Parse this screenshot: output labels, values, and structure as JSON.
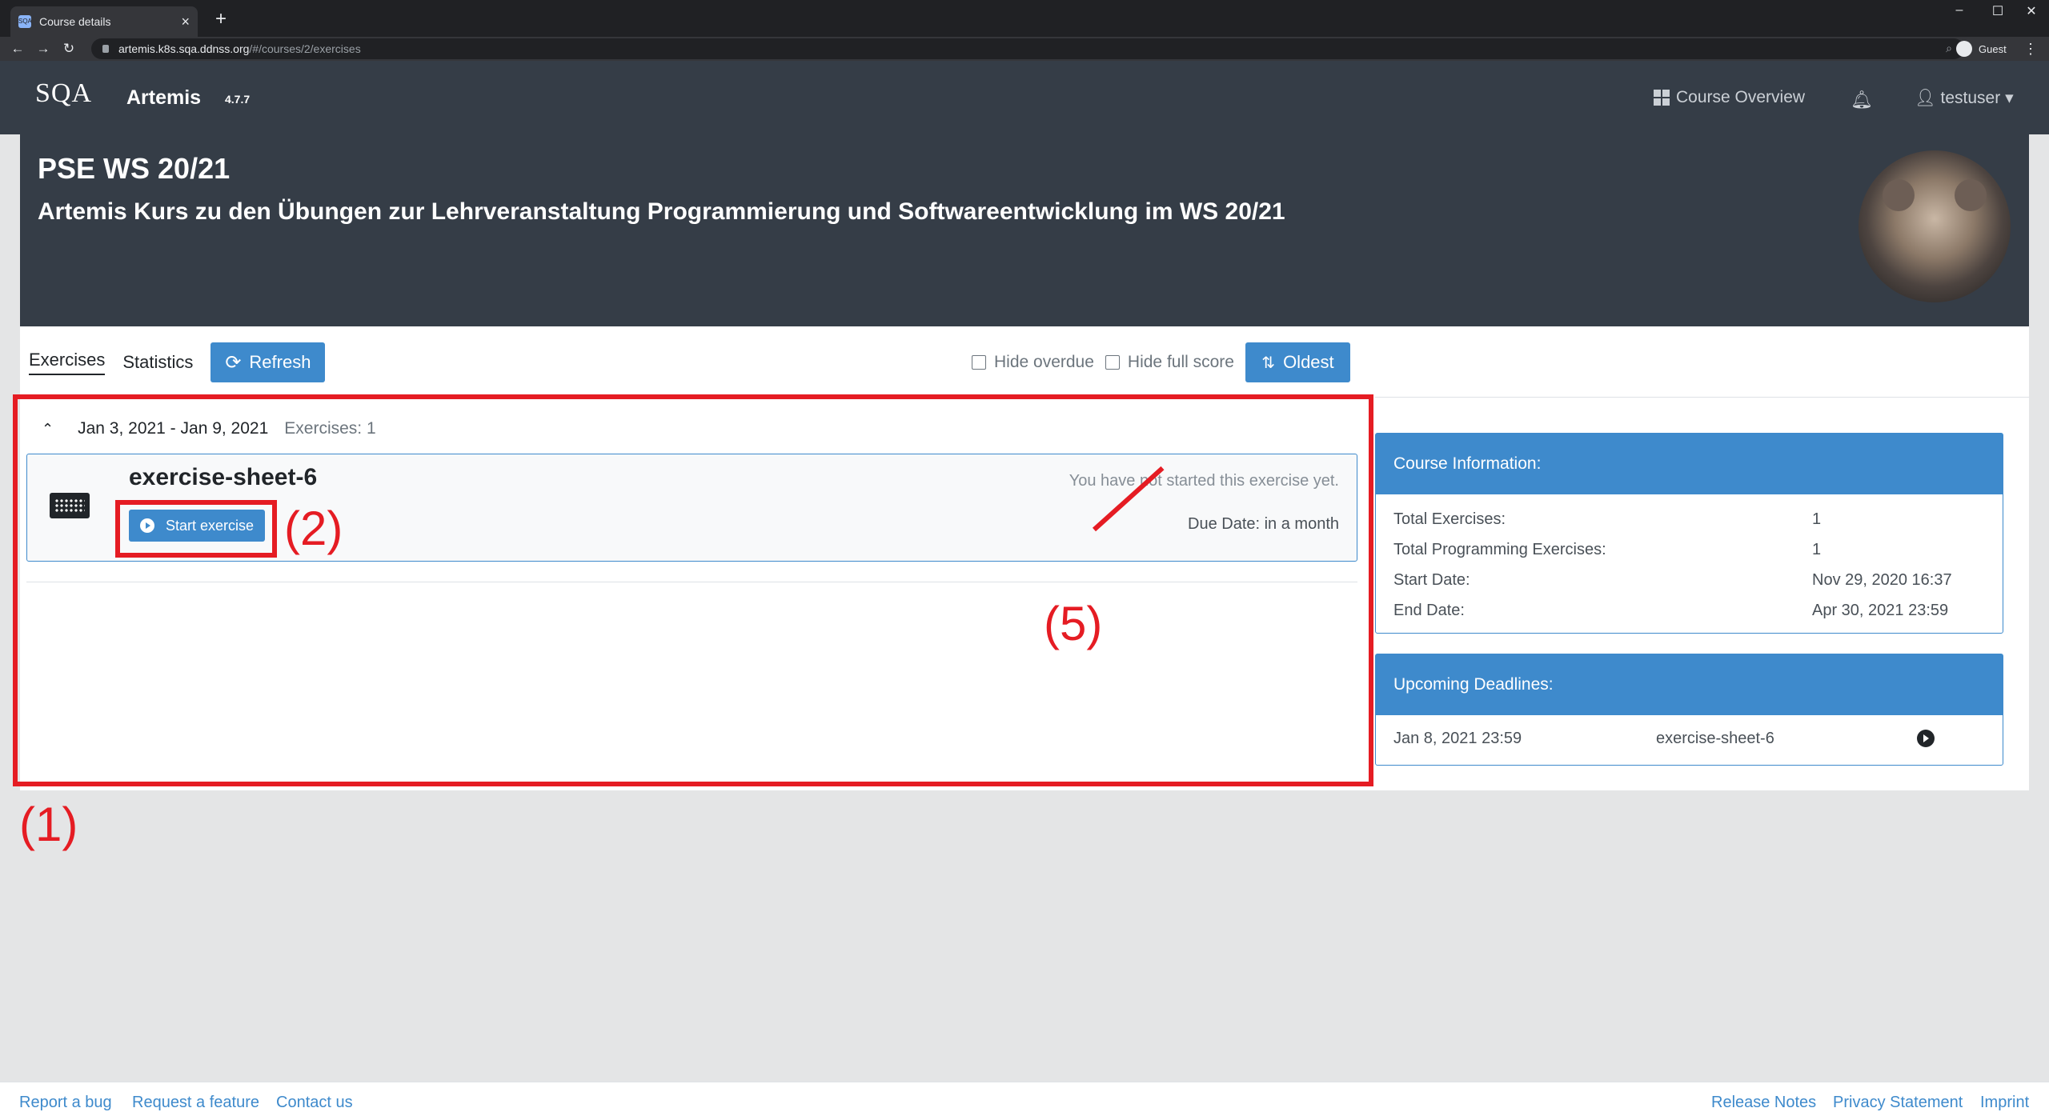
{
  "browser": {
    "tab_title": "Course details",
    "favicon_text": "SQA",
    "url_host": "artemis.k8s.sqa.ddnss.org",
    "url_path": "/#/courses/2/exercises",
    "profile_label": "Guest"
  },
  "navbar": {
    "logo": "SQA",
    "brand": "Artemis",
    "version": "4.7.7",
    "course_overview": "Course Overview",
    "user": "testuser"
  },
  "course": {
    "title": "PSE WS 20/21",
    "description": "Artemis Kurs zu den Übungen zur Lehrveranstaltung Programmierung und Softwareentwicklung im WS 20/21"
  },
  "subnav": {
    "exercises": "Exercises",
    "statistics": "Statistics",
    "refresh": "Refresh",
    "hide_overdue": "Hide overdue",
    "hide_full_score": "Hide full score",
    "sort": "Oldest"
  },
  "group": {
    "range": "Jan 3, 2021 - Jan 9, 2021",
    "count": "Exercises: 1"
  },
  "exercise": {
    "title": "exercise-sheet-6",
    "start_label": "Start exercise",
    "status": "You have not started this exercise yet.",
    "due": "Due Date: in a month"
  },
  "course_info": {
    "header": "Course Information:",
    "rows": [
      {
        "label": "Total Exercises:",
        "value": "1"
      },
      {
        "label": "Total Programming Exercises:",
        "value": "1"
      },
      {
        "label": "Start Date:",
        "value": "Nov 29, 2020 16:37"
      },
      {
        "label": "End Date:",
        "value": "Apr 30, 2021 23:59"
      }
    ]
  },
  "deadlines": {
    "header": "Upcoming Deadlines:",
    "items": [
      {
        "date": "Jan 8, 2021 23:59",
        "name": "exercise-sheet-6"
      }
    ]
  },
  "annotations": {
    "label1": "(1)",
    "label2": "(2)",
    "label5": "(5)"
  },
  "footer": {
    "report_bug": "Report a bug",
    "request_feature": "Request a feature",
    "contact": "Contact us",
    "release_notes": "Release Notes",
    "privacy": "Privacy Statement",
    "imprint": "Imprint"
  },
  "colors": {
    "primary": "#3e8acc",
    "navbar": "#353d47",
    "annotation": "#e51c23"
  }
}
